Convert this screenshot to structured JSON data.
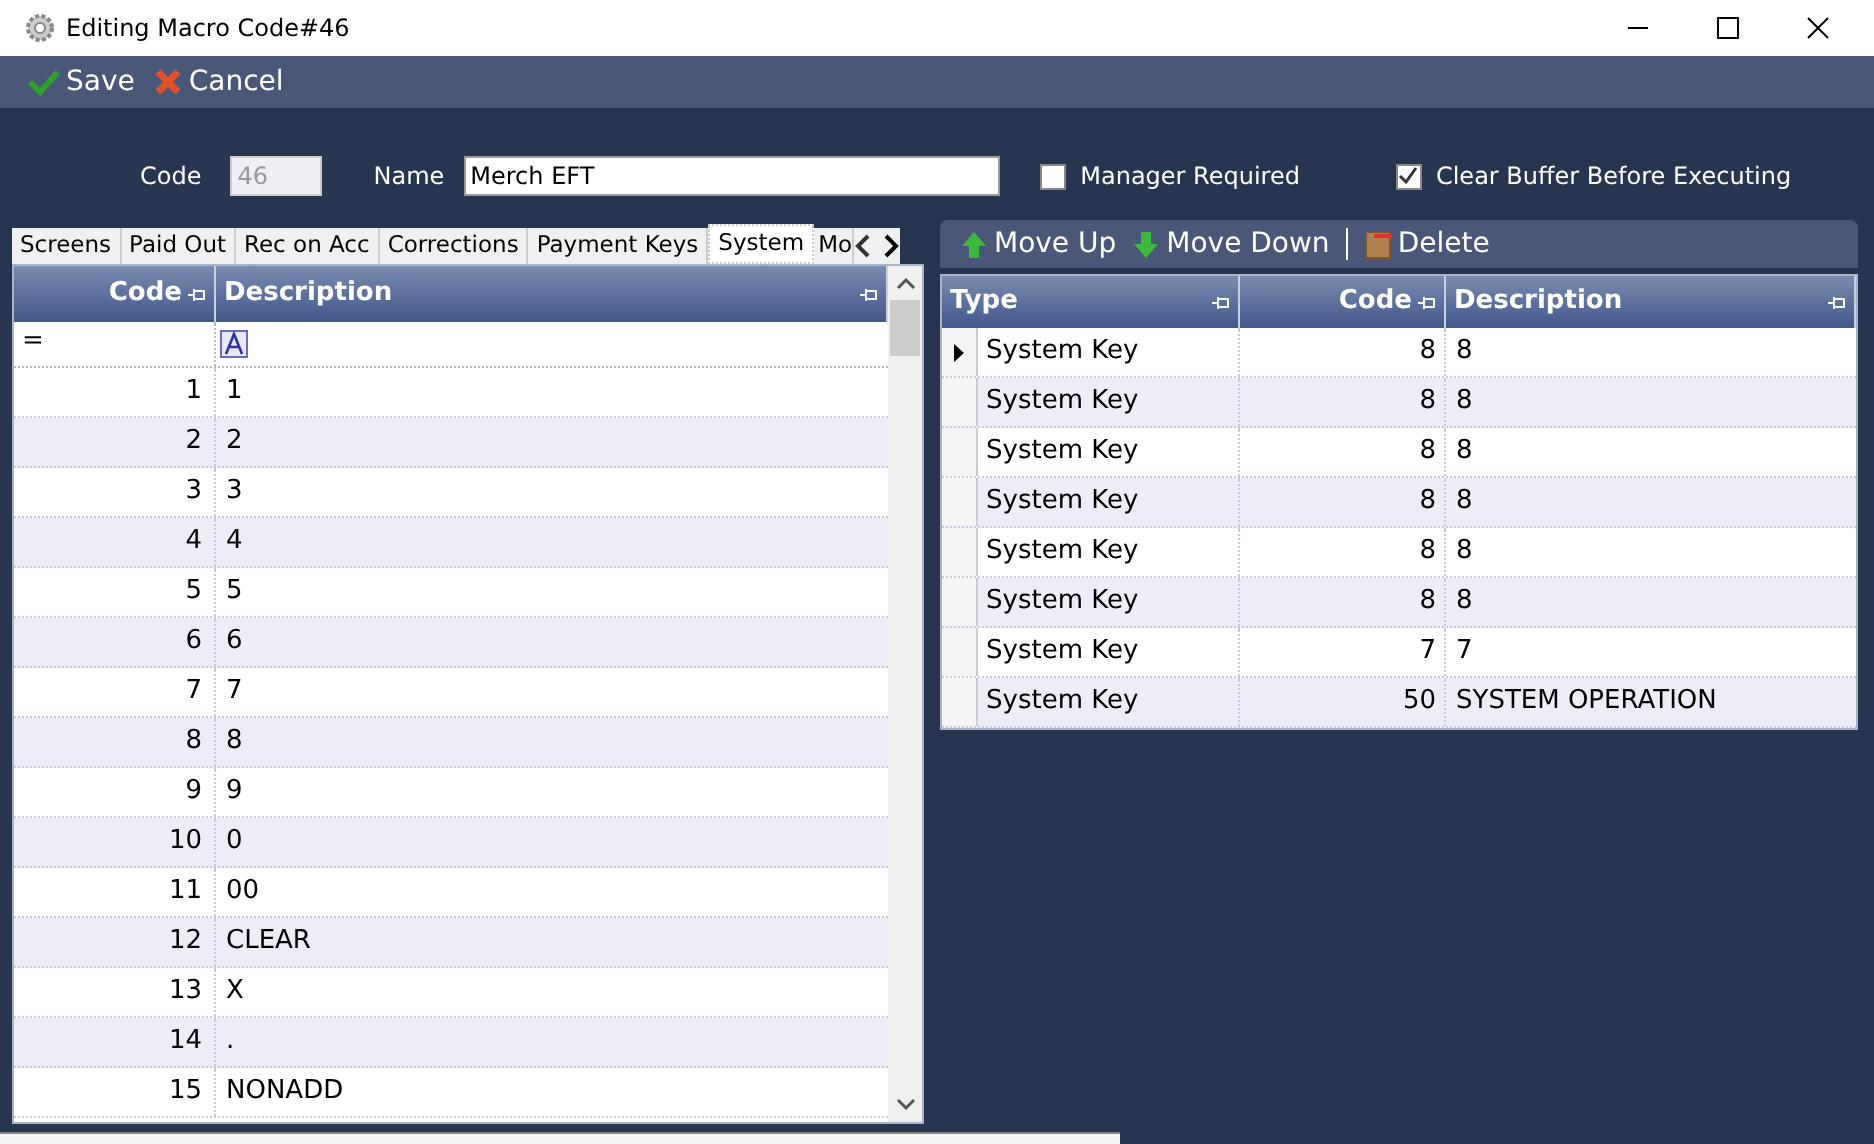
{
  "window": {
    "title": "Editing Macro Code#46"
  },
  "toolbar": {
    "buttons": [
      {
        "kind": "save",
        "label": "Save"
      },
      {
        "kind": "cancel",
        "label": "Cancel"
      }
    ]
  },
  "form": {
    "code_label": "Code",
    "code_value": "46",
    "name_label": "Name",
    "name_value": "Merch EFT",
    "checkboxes": [
      {
        "label": "Manager Required",
        "checked": false
      },
      {
        "label": "Clear Buffer Before Executing",
        "checked": true
      }
    ]
  },
  "tabs": [
    {
      "label": "Screens",
      "selected": false
    },
    {
      "label": "Paid Out",
      "selected": false
    },
    {
      "label": "Rec on Acc",
      "selected": false
    },
    {
      "label": "Corrections",
      "selected": false
    },
    {
      "label": "Payment Keys",
      "selected": false
    },
    {
      "label": "System",
      "selected": true
    },
    {
      "label": "Mo",
      "selected": false
    }
  ],
  "left_table": {
    "columns": [
      "Code",
      "Description"
    ],
    "filter_operator": "=",
    "rows": [
      [
        "1",
        "1"
      ],
      [
        "2",
        "2"
      ],
      [
        "3",
        "3"
      ],
      [
        "4",
        "4"
      ],
      [
        "5",
        "5"
      ],
      [
        "6",
        "6"
      ],
      [
        "7",
        "7"
      ],
      [
        "8",
        "8"
      ],
      [
        "9",
        "9"
      ],
      [
        "10",
        "0"
      ],
      [
        "11",
        "00"
      ],
      [
        "12",
        "CLEAR"
      ],
      [
        "13",
        "X"
      ],
      [
        "14",
        "."
      ],
      [
        "15",
        "NONADD"
      ]
    ]
  },
  "right_toolbar": {
    "buttons": [
      {
        "kind": "up",
        "label": "Move Up"
      },
      {
        "kind": "down",
        "label": "Move Down"
      },
      {
        "kind": "delete",
        "label": "Delete"
      }
    ]
  },
  "right_table": {
    "columns": [
      "Type",
      "Code",
      "Description"
    ],
    "rows": [
      {
        "cells": [
          "System Key",
          "8",
          "8"
        ],
        "selected": true
      },
      {
        "cells": [
          "System Key",
          "8",
          "8"
        ],
        "selected": false
      },
      {
        "cells": [
          "System Key",
          "8",
          "8"
        ],
        "selected": false
      },
      {
        "cells": [
          "System Key",
          "8",
          "8"
        ],
        "selected": false
      },
      {
        "cells": [
          "System Key",
          "8",
          "8"
        ],
        "selected": false
      },
      {
        "cells": [
          "System Key",
          "8",
          "8"
        ],
        "selected": false
      },
      {
        "cells": [
          "System Key",
          "7",
          "7"
        ],
        "selected": false
      },
      {
        "cells": [
          "System Key",
          "50",
          "SYSTEM OPERATION"
        ],
        "selected": false
      }
    ]
  }
}
